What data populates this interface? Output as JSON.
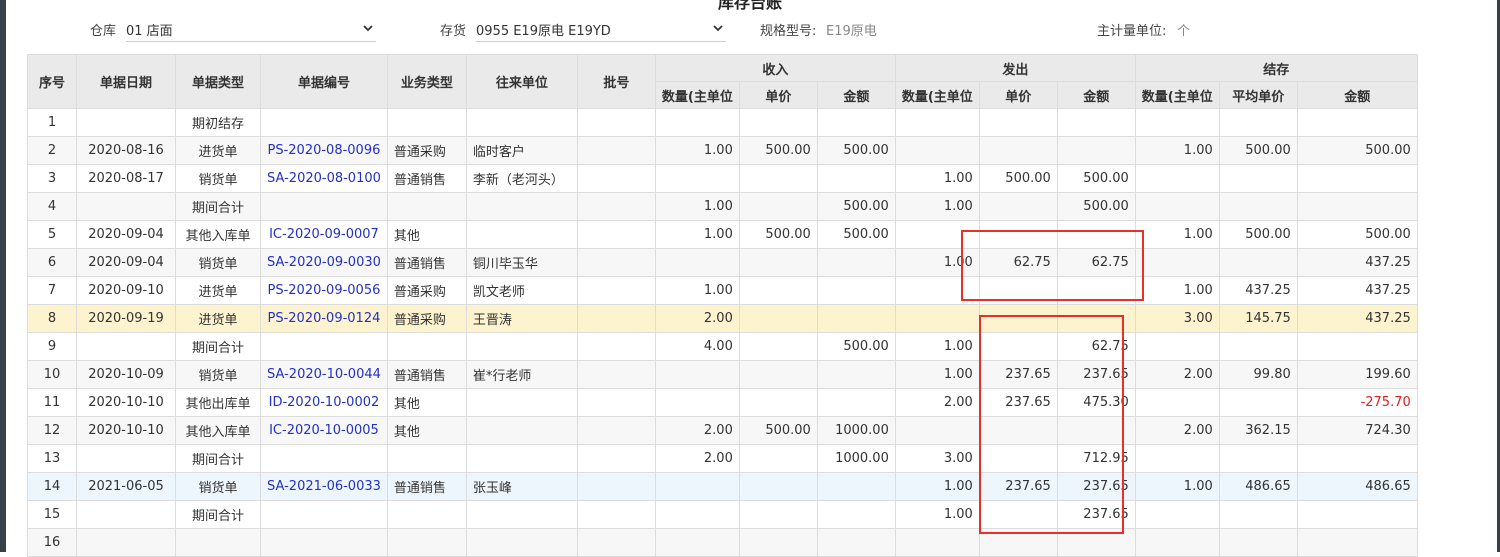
{
  "page_title": "库存台账",
  "filters": {
    "warehouse": {
      "label": "仓库",
      "value": "01 店面"
    },
    "inventory": {
      "label": "存货",
      "value": "0955 E19原电 E19YD"
    },
    "spec": {
      "label": "规格型号:",
      "value": "E19原电"
    },
    "unit": {
      "label": "主计量单位:",
      "value": "个"
    }
  },
  "columns": {
    "seq": "序号",
    "date": "单据日期",
    "doc_type": "单据类型",
    "doc_no": "单据编号",
    "biz_type": "业务类型",
    "partner": "往来单位",
    "batch": "批号",
    "group_in": "收入",
    "group_out": "发出",
    "group_balance": "结存",
    "in_qty": "数量(主单位",
    "in_price": "单价",
    "in_amount": "金额",
    "out_qty": "数量(主单位",
    "out_price": "单价",
    "out_amount": "金额",
    "bal_qty": "数量(主单位",
    "bal_avg_price": "平均单价",
    "bal_amount": "金额"
  },
  "rows": [
    {
      "seq": "1",
      "date": "",
      "doc_type": "期初结存",
      "doc_no": "",
      "biz_type": "",
      "partner": "",
      "batch": "",
      "in_qty": "",
      "in_price": "",
      "in_amount": "",
      "out_qty": "",
      "out_price": "",
      "out_amount": "",
      "bal_qty": "",
      "bal_avg_price": "",
      "bal_amount": ""
    },
    {
      "seq": "2",
      "date": "2020-08-16",
      "doc_type": "进货单",
      "doc_no": "PS-2020-08-0096",
      "biz_type": "普通采购",
      "partner": "临时客户",
      "batch": "",
      "in_qty": "1.00",
      "in_price": "500.00",
      "in_amount": "500.00",
      "out_qty": "",
      "out_price": "",
      "out_amount": "",
      "bal_qty": "1.00",
      "bal_avg_price": "500.00",
      "bal_amount": "500.00"
    },
    {
      "seq": "3",
      "date": "2020-08-17",
      "doc_type": "销货单",
      "doc_no": "SA-2020-08-0100",
      "biz_type": "普通销售",
      "partner": "李新（老河头）",
      "batch": "",
      "in_qty": "",
      "in_price": "",
      "in_amount": "",
      "out_qty": "1.00",
      "out_price": "500.00",
      "out_amount": "500.00",
      "bal_qty": "",
      "bal_avg_price": "",
      "bal_amount": ""
    },
    {
      "seq": "4",
      "date": "",
      "doc_type": "期间合计",
      "doc_no": "",
      "biz_type": "",
      "partner": "",
      "batch": "",
      "in_qty": "1.00",
      "in_price": "",
      "in_amount": "500.00",
      "out_qty": "1.00",
      "out_price": "",
      "out_amount": "500.00",
      "bal_qty": "",
      "bal_avg_price": "",
      "bal_amount": ""
    },
    {
      "seq": "5",
      "date": "2020-09-04",
      "doc_type": "其他入库单",
      "doc_no": "IC-2020-09-0007",
      "biz_type": "其他",
      "partner": "",
      "batch": "",
      "in_qty": "1.00",
      "in_price": "500.00",
      "in_amount": "500.00",
      "out_qty": "",
      "out_price": "",
      "out_amount": "",
      "bal_qty": "1.00",
      "bal_avg_price": "500.00",
      "bal_amount": "500.00"
    },
    {
      "seq": "6",
      "date": "2020-09-04",
      "doc_type": "销货单",
      "doc_no": "SA-2020-09-0030",
      "biz_type": "普通销售",
      "partner": "铜川毕玉华",
      "batch": "",
      "in_qty": "",
      "in_price": "",
      "in_amount": "",
      "out_qty": "1.00",
      "out_price": "62.75",
      "out_amount": "62.75",
      "bal_qty": "",
      "bal_avg_price": "",
      "bal_amount": "437.25"
    },
    {
      "seq": "7",
      "date": "2020-09-10",
      "doc_type": "进货单",
      "doc_no": "PS-2020-09-0056",
      "biz_type": "普通采购",
      "partner": "凯文老师",
      "batch": "",
      "in_qty": "1.00",
      "in_price": "",
      "in_amount": "",
      "out_qty": "",
      "out_price": "",
      "out_amount": "",
      "bal_qty": "1.00",
      "bal_avg_price": "437.25",
      "bal_amount": "437.25"
    },
    {
      "seq": "8",
      "date": "2020-09-19",
      "doc_type": "进货单",
      "doc_no": "PS-2020-09-0124",
      "biz_type": "普通采购",
      "partner": "王晋涛",
      "batch": "",
      "in_qty": "2.00",
      "in_price": "",
      "in_amount": "",
      "out_qty": "",
      "out_price": "",
      "out_amount": "",
      "bal_qty": "3.00",
      "bal_avg_price": "145.75",
      "bal_amount": "437.25"
    },
    {
      "seq": "9",
      "date": "",
      "doc_type": "期间合计",
      "doc_no": "",
      "biz_type": "",
      "partner": "",
      "batch": "",
      "in_qty": "4.00",
      "in_price": "",
      "in_amount": "500.00",
      "out_qty": "1.00",
      "out_price": "",
      "out_amount": "62.75",
      "bal_qty": "",
      "bal_avg_price": "",
      "bal_amount": ""
    },
    {
      "seq": "10",
      "date": "2020-10-09",
      "doc_type": "销货单",
      "doc_no": "SA-2020-10-0044",
      "biz_type": "普通销售",
      "partner": "崔*行老师",
      "batch": "",
      "in_qty": "",
      "in_price": "",
      "in_amount": "",
      "out_qty": "1.00",
      "out_price": "237.65",
      "out_amount": "237.65",
      "bal_qty": "2.00",
      "bal_avg_price": "99.80",
      "bal_amount": "199.60"
    },
    {
      "seq": "11",
      "date": "2020-10-10",
      "doc_type": "其他出库单",
      "doc_no": "ID-2020-10-0002",
      "biz_type": "其他",
      "partner": "",
      "batch": "",
      "in_qty": "",
      "in_price": "",
      "in_amount": "",
      "out_qty": "2.00",
      "out_price": "237.65",
      "out_amount": "475.30",
      "bal_qty": "",
      "bal_avg_price": "",
      "bal_amount": "-275.70"
    },
    {
      "seq": "12",
      "date": "2020-10-10",
      "doc_type": "其他入库单",
      "doc_no": "IC-2020-10-0005",
      "biz_type": "其他",
      "partner": "",
      "batch": "",
      "in_qty": "2.00",
      "in_price": "500.00",
      "in_amount": "1000.00",
      "out_qty": "",
      "out_price": "",
      "out_amount": "",
      "bal_qty": "2.00",
      "bal_avg_price": "362.15",
      "bal_amount": "724.30"
    },
    {
      "seq": "13",
      "date": "",
      "doc_type": "期间合计",
      "doc_no": "",
      "biz_type": "",
      "partner": "",
      "batch": "",
      "in_qty": "2.00",
      "in_price": "",
      "in_amount": "1000.00",
      "out_qty": "3.00",
      "out_price": "",
      "out_amount": "712.95",
      "bal_qty": "",
      "bal_avg_price": "",
      "bal_amount": ""
    },
    {
      "seq": "14",
      "date": "2021-06-05",
      "doc_type": "销货单",
      "doc_no": "SA-2021-06-0033",
      "biz_type": "普通销售",
      "partner": "张玉峰",
      "batch": "",
      "in_qty": "",
      "in_price": "",
      "in_amount": "",
      "out_qty": "1.00",
      "out_price": "237.65",
      "out_amount": "237.65",
      "bal_qty": "1.00",
      "bal_avg_price": "486.65",
      "bal_amount": "486.65"
    },
    {
      "seq": "15",
      "date": "",
      "doc_type": "期间合计",
      "doc_no": "",
      "biz_type": "",
      "partner": "",
      "batch": "",
      "in_qty": "",
      "in_price": "",
      "in_amount": "",
      "out_qty": "1.00",
      "out_price": "",
      "out_amount": "237.65",
      "bal_qty": "",
      "bal_avg_price": "",
      "bal_amount": ""
    },
    {
      "seq": "16",
      "date": "",
      "doc_type": "",
      "doc_no": "",
      "biz_type": "",
      "partner": "",
      "batch": "",
      "in_qty": "",
      "in_price": "",
      "in_amount": "",
      "out_qty": "",
      "out_price": "",
      "out_amount": "",
      "bal_qty": "",
      "bal_avg_price": "",
      "bal_amount": ""
    }
  ],
  "selected_row": 7,
  "hover_row": 13,
  "negative_color": "#e02020",
  "link_color": "#2330c8",
  "highlight_color": "#e4322b"
}
